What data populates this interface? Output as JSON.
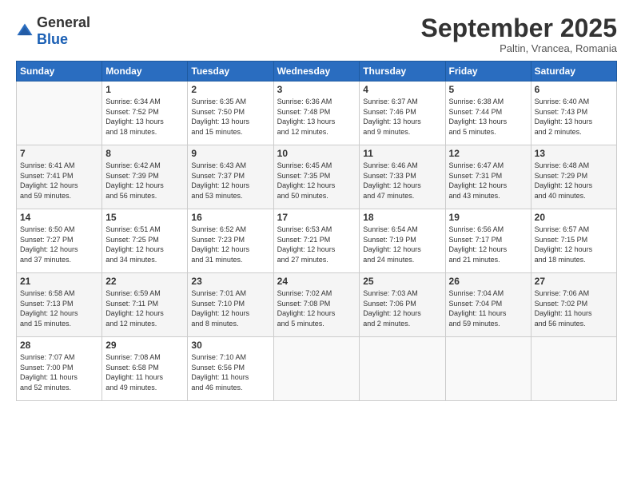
{
  "logo": {
    "general": "General",
    "blue": "Blue"
  },
  "title": "September 2025",
  "location": "Paltin, Vrancea, Romania",
  "days_header": [
    "Sunday",
    "Monday",
    "Tuesday",
    "Wednesday",
    "Thursday",
    "Friday",
    "Saturday"
  ],
  "weeks": [
    [
      {
        "num": "",
        "info": ""
      },
      {
        "num": "1",
        "info": "Sunrise: 6:34 AM\nSunset: 7:52 PM\nDaylight: 13 hours\nand 18 minutes."
      },
      {
        "num": "2",
        "info": "Sunrise: 6:35 AM\nSunset: 7:50 PM\nDaylight: 13 hours\nand 15 minutes."
      },
      {
        "num": "3",
        "info": "Sunrise: 6:36 AM\nSunset: 7:48 PM\nDaylight: 13 hours\nand 12 minutes."
      },
      {
        "num": "4",
        "info": "Sunrise: 6:37 AM\nSunset: 7:46 PM\nDaylight: 13 hours\nand 9 minutes."
      },
      {
        "num": "5",
        "info": "Sunrise: 6:38 AM\nSunset: 7:44 PM\nDaylight: 13 hours\nand 5 minutes."
      },
      {
        "num": "6",
        "info": "Sunrise: 6:40 AM\nSunset: 7:43 PM\nDaylight: 13 hours\nand 2 minutes."
      }
    ],
    [
      {
        "num": "7",
        "info": "Sunrise: 6:41 AM\nSunset: 7:41 PM\nDaylight: 12 hours\nand 59 minutes."
      },
      {
        "num": "8",
        "info": "Sunrise: 6:42 AM\nSunset: 7:39 PM\nDaylight: 12 hours\nand 56 minutes."
      },
      {
        "num": "9",
        "info": "Sunrise: 6:43 AM\nSunset: 7:37 PM\nDaylight: 12 hours\nand 53 minutes."
      },
      {
        "num": "10",
        "info": "Sunrise: 6:45 AM\nSunset: 7:35 PM\nDaylight: 12 hours\nand 50 minutes."
      },
      {
        "num": "11",
        "info": "Sunrise: 6:46 AM\nSunset: 7:33 PM\nDaylight: 12 hours\nand 47 minutes."
      },
      {
        "num": "12",
        "info": "Sunrise: 6:47 AM\nSunset: 7:31 PM\nDaylight: 12 hours\nand 43 minutes."
      },
      {
        "num": "13",
        "info": "Sunrise: 6:48 AM\nSunset: 7:29 PM\nDaylight: 12 hours\nand 40 minutes."
      }
    ],
    [
      {
        "num": "14",
        "info": "Sunrise: 6:50 AM\nSunset: 7:27 PM\nDaylight: 12 hours\nand 37 minutes."
      },
      {
        "num": "15",
        "info": "Sunrise: 6:51 AM\nSunset: 7:25 PM\nDaylight: 12 hours\nand 34 minutes."
      },
      {
        "num": "16",
        "info": "Sunrise: 6:52 AM\nSunset: 7:23 PM\nDaylight: 12 hours\nand 31 minutes."
      },
      {
        "num": "17",
        "info": "Sunrise: 6:53 AM\nSunset: 7:21 PM\nDaylight: 12 hours\nand 27 minutes."
      },
      {
        "num": "18",
        "info": "Sunrise: 6:54 AM\nSunset: 7:19 PM\nDaylight: 12 hours\nand 24 minutes."
      },
      {
        "num": "19",
        "info": "Sunrise: 6:56 AM\nSunset: 7:17 PM\nDaylight: 12 hours\nand 21 minutes."
      },
      {
        "num": "20",
        "info": "Sunrise: 6:57 AM\nSunset: 7:15 PM\nDaylight: 12 hours\nand 18 minutes."
      }
    ],
    [
      {
        "num": "21",
        "info": "Sunrise: 6:58 AM\nSunset: 7:13 PM\nDaylight: 12 hours\nand 15 minutes."
      },
      {
        "num": "22",
        "info": "Sunrise: 6:59 AM\nSunset: 7:11 PM\nDaylight: 12 hours\nand 12 minutes."
      },
      {
        "num": "23",
        "info": "Sunrise: 7:01 AM\nSunset: 7:10 PM\nDaylight: 12 hours\nand 8 minutes."
      },
      {
        "num": "24",
        "info": "Sunrise: 7:02 AM\nSunset: 7:08 PM\nDaylight: 12 hours\nand 5 minutes."
      },
      {
        "num": "25",
        "info": "Sunrise: 7:03 AM\nSunset: 7:06 PM\nDaylight: 12 hours\nand 2 minutes."
      },
      {
        "num": "26",
        "info": "Sunrise: 7:04 AM\nSunset: 7:04 PM\nDaylight: 11 hours\nand 59 minutes."
      },
      {
        "num": "27",
        "info": "Sunrise: 7:06 AM\nSunset: 7:02 PM\nDaylight: 11 hours\nand 56 minutes."
      }
    ],
    [
      {
        "num": "28",
        "info": "Sunrise: 7:07 AM\nSunset: 7:00 PM\nDaylight: 11 hours\nand 52 minutes."
      },
      {
        "num": "29",
        "info": "Sunrise: 7:08 AM\nSunset: 6:58 PM\nDaylight: 11 hours\nand 49 minutes."
      },
      {
        "num": "30",
        "info": "Sunrise: 7:10 AM\nSunset: 6:56 PM\nDaylight: 11 hours\nand 46 minutes."
      },
      {
        "num": "",
        "info": ""
      },
      {
        "num": "",
        "info": ""
      },
      {
        "num": "",
        "info": ""
      },
      {
        "num": "",
        "info": ""
      }
    ]
  ]
}
